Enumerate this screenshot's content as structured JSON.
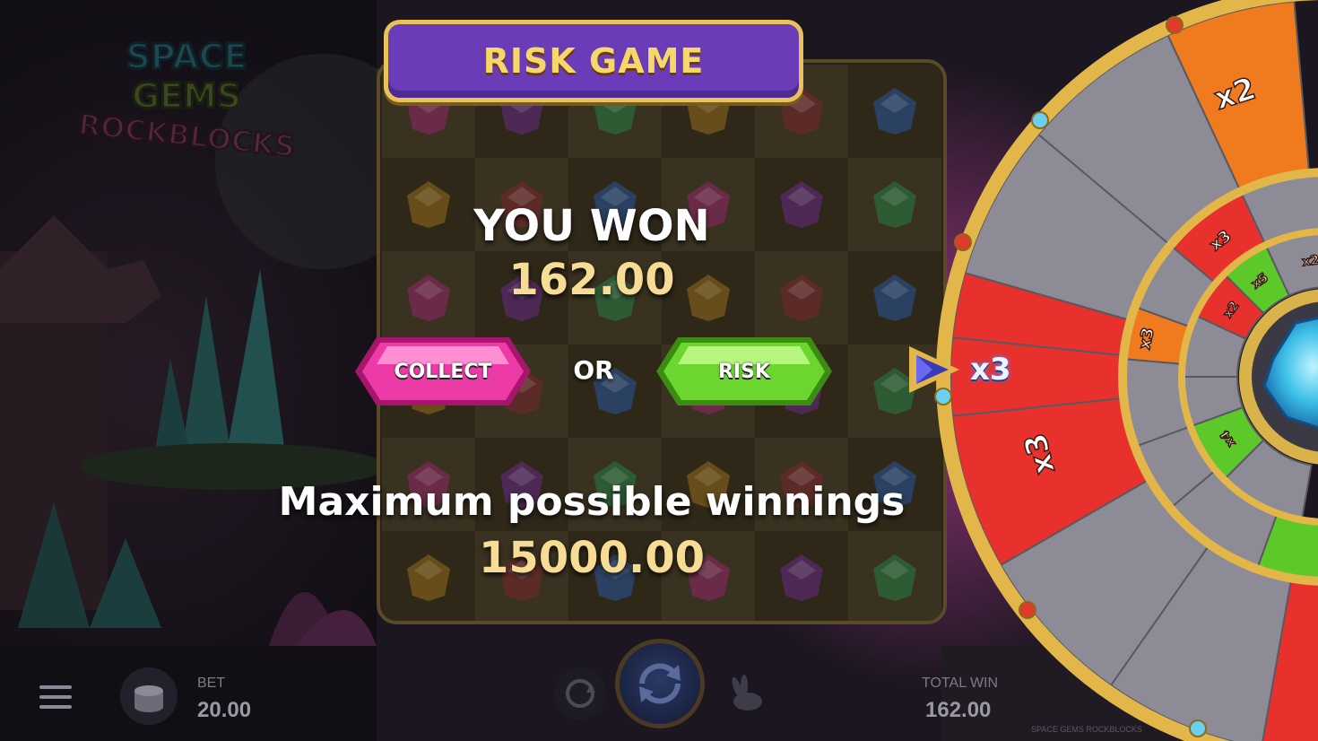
{
  "game": {
    "logo_lines": [
      "SPACE",
      "GEMS",
      "ROCKBLOCKS"
    ]
  },
  "risk_panel": {
    "title": "RISK GAME",
    "won_label": "YOU WON",
    "won_amount": "162.00",
    "collect_label": "COLLECT",
    "or_label": "OR",
    "risk_label": "RISK",
    "max_label": "Maximum possible winnings",
    "max_amount": "15000.00"
  },
  "wheel": {
    "current_multiplier": "x3",
    "outer_ring_labels": [
      "x2",
      "x3",
      "x3"
    ],
    "middle_ring_labels": [
      "x3",
      "x3"
    ],
    "inner_ring_labels": [
      "x5",
      "x2",
      "x2",
      "x4"
    ],
    "colors": {
      "red": "#e8302c",
      "orange": "#f07a1e",
      "green": "#5cc82a",
      "gray": "#8d8c96",
      "gold": "#e2b648"
    }
  },
  "bottom_bar": {
    "bet_label": "BET",
    "bet_value": "20.00",
    "total_win_label": "TOTAL WIN",
    "total_win_value": "162.00",
    "footer": "SPACE GEMS ROCKBLOCKS"
  },
  "icons": [
    "menu-icon",
    "coins-icon",
    "autoplay-icon",
    "spin-icon",
    "turbo-icon",
    "pointer-gem-icon"
  ]
}
